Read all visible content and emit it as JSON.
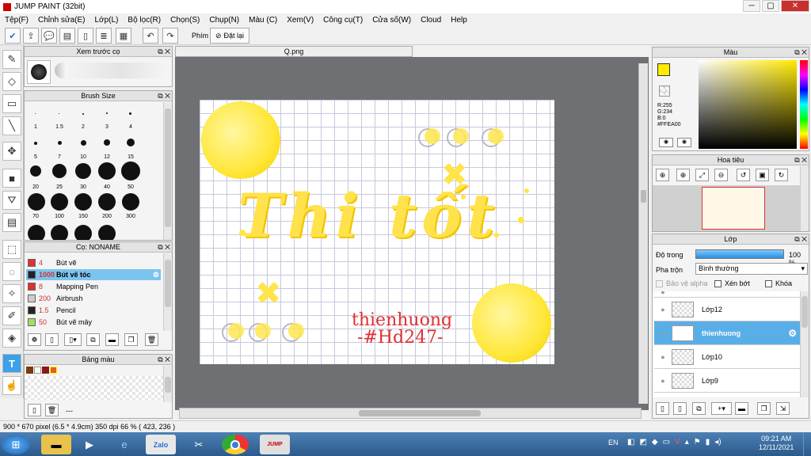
{
  "window": {
    "title": "JUMP PAINT (32bit)"
  },
  "menu": [
    "Tệp(F)",
    "Chỉnh sửa(E)",
    "Lớp(L)",
    "Bộ lọc(R)",
    "Chọn(S)",
    "Chụp(N)",
    "Màu (C)",
    "Xem(V)",
    "Công cụ(T)",
    "Cửa số(W)",
    "Cloud",
    "Help"
  ],
  "toolbar": {
    "shortcut_label": "Phím",
    "reset_label": "Đặt lại"
  },
  "panels": {
    "preview": {
      "title": "Xem trước cọ"
    },
    "brush_size": {
      "title": "Brush Size",
      "sizes": [
        "1",
        "1.5",
        "2",
        "3",
        "4",
        "5",
        "7",
        "10",
        "12",
        "15",
        "20",
        "25",
        "30",
        "40",
        "50",
        "70",
        "100",
        "150",
        "200",
        "300"
      ]
    },
    "brush": {
      "title": "Cọ: NONAME",
      "items": [
        {
          "size": "4",
          "name": "Bút vẽ",
          "color": "#e03030"
        },
        {
          "size": "1000",
          "name": "Bút vẽ tóc",
          "color": "#222222"
        },
        {
          "size": "8",
          "name": "Mapping Pen",
          "color": "#e03030"
        },
        {
          "size": "200",
          "name": "Airbrush",
          "color": "#cccccc"
        },
        {
          "size": "1.5",
          "name": "Pencil",
          "color": "#222222"
        },
        {
          "size": "50",
          "name": "Bút vẽ mây",
          "color": "#a0e060"
        }
      ],
      "selected_index": 1
    },
    "palette": {
      "title": "Bảng màu",
      "footer": "---"
    },
    "color": {
      "title": "Màu",
      "r": "R:255",
      "g": "G:234",
      "b": "B:0",
      "hex": "#FFEA00",
      "swatch": "#FFEA00"
    },
    "navigator": {
      "title": "Hoa tiêu"
    },
    "layers": {
      "title": "Lớp",
      "opacity_label": "Độ trong",
      "opacity_value": "100 %",
      "opacity_fraction": 1.0,
      "blend_label": "Pha trộn",
      "blend_value": "Bình thường",
      "protect_alpha": "Bảo vệ alpha",
      "clipping": "Xén bớt",
      "lock": "Khóa",
      "rows": [
        {
          "name": "Lớp12"
        },
        {
          "name": "thienhuong"
        },
        {
          "name": "Lớp10"
        },
        {
          "name": "Lớp9"
        }
      ],
      "selected_index": 1
    }
  },
  "document": {
    "tab": "Q.png"
  },
  "artwork": {
    "main_text": "Thi tốt",
    "signature_name": "thienhuong",
    "signature_tag": "-#Hd247-"
  },
  "status": {
    "text": "900 * 670 pixel   (6.5 * 4.9cm)   350 dpi   66 %   ( 423, 236 )"
  },
  "taskbar": {
    "lang": "EN",
    "time": "09:21 AM",
    "date": "12/11/2021"
  }
}
